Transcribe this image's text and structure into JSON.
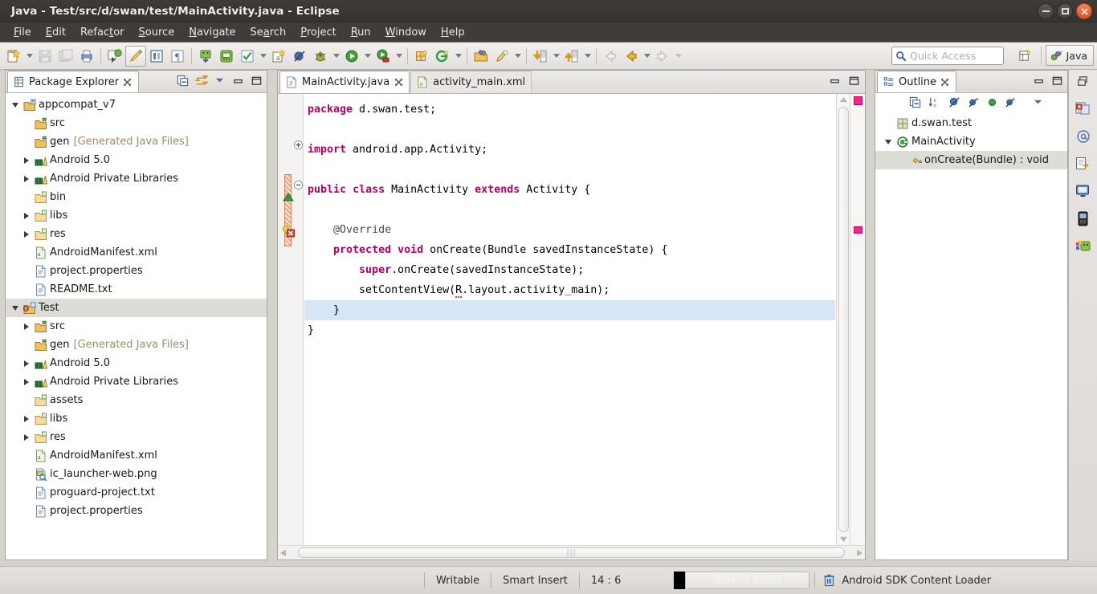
{
  "window": {
    "title": "Java - Test/src/d/swan/test/MainActivity.java - Eclipse",
    "controls": {
      "minimize": "minimize-button",
      "maximize": "maximize-button",
      "close": "close-button"
    }
  },
  "menu": {
    "items": [
      {
        "label": "File",
        "mnemonic": "F"
      },
      {
        "label": "Edit",
        "mnemonic": "E"
      },
      {
        "label": "Refactor",
        "mnemonic": "t"
      },
      {
        "label": "Source",
        "mnemonic": "S"
      },
      {
        "label": "Navigate",
        "mnemonic": "N"
      },
      {
        "label": "Search",
        "mnemonic": "a"
      },
      {
        "label": "Project",
        "mnemonic": "P"
      },
      {
        "label": "Run",
        "mnemonic": "R"
      },
      {
        "label": "Window",
        "mnemonic": "W"
      },
      {
        "label": "Help",
        "mnemonic": "H"
      }
    ]
  },
  "toolbar": {
    "quick_access": {
      "placeholder": "Quick Access",
      "icon": "search-icon"
    },
    "perspective": {
      "label": "Java",
      "icon": "java-perspective-icon",
      "open_perspective_icon": "open-perspective-icon"
    },
    "buttons": [
      "new-wizard-button",
      "save-button",
      "save-all-button",
      "print-button",
      "new-android-app-button",
      "toggle-highlight-button",
      "toggle-block-selection-button",
      "toggle-whitespace-button",
      "android-sdk-manager-button",
      "android-avd-manager-button",
      "check-button",
      "new-java-package-button",
      "skip-breakpoints-button",
      "debug-button",
      "run-button",
      "run-configurations-button",
      "new-android-xml-button",
      "new-android-activity-button",
      "open-type-button",
      "search-button",
      "next-annotation-button",
      "previous-annotation-button",
      "back-button",
      "forward-button"
    ]
  },
  "package_explorer": {
    "title": "Package Explorer",
    "close_icon": "close-view-icon",
    "tools": [
      "collapse-all-icon",
      "link-with-editor-icon",
      "view-menu-icon",
      "minimize-icon",
      "maximize-icon"
    ],
    "tree": [
      {
        "label": "appcompat_v7",
        "indent": 0,
        "twist": "open",
        "icon": "java-project-icon",
        "selected": false
      },
      {
        "label": "src",
        "indent": 1,
        "twist": "none",
        "icon": "source-folder-icon",
        "selected": false
      },
      {
        "label": "gen",
        "indent": 1,
        "twist": "none",
        "icon": "source-folder-icon",
        "suffix": "[Generated Java Files]",
        "selected": false
      },
      {
        "label": "Android 5.0",
        "indent": 1,
        "twist": "closed",
        "icon": "library-icon",
        "selected": false
      },
      {
        "label": "Android Private Libraries",
        "indent": 1,
        "twist": "closed",
        "icon": "library-icon",
        "selected": false
      },
      {
        "label": "bin",
        "indent": 1,
        "twist": "none",
        "icon": "folder-icon",
        "selected": false
      },
      {
        "label": "libs",
        "indent": 1,
        "twist": "closed",
        "icon": "folder-icon",
        "selected": false
      },
      {
        "label": "res",
        "indent": 1,
        "twist": "closed",
        "icon": "folder-icon",
        "selected": false
      },
      {
        "label": "AndroidManifest.xml",
        "indent": 1,
        "twist": "none",
        "icon": "android-xml-icon",
        "selected": false
      },
      {
        "label": "project.properties",
        "indent": 1,
        "twist": "none",
        "icon": "text-file-icon",
        "selected": false
      },
      {
        "label": "README.txt",
        "indent": 1,
        "twist": "none",
        "icon": "text-file-icon",
        "selected": false
      },
      {
        "label": "Test",
        "indent": 0,
        "twist": "open",
        "icon": "java-project-error-icon",
        "selected": true
      },
      {
        "label": "src",
        "indent": 1,
        "twist": "closed",
        "icon": "source-folder-icon",
        "selected": false
      },
      {
        "label": "gen",
        "indent": 1,
        "twist": "none",
        "icon": "source-folder-icon",
        "suffix": "[Generated Java Files]",
        "selected": false
      },
      {
        "label": "Android 5.0",
        "indent": 1,
        "twist": "closed",
        "icon": "library-icon",
        "selected": false
      },
      {
        "label": "Android Private Libraries",
        "indent": 1,
        "twist": "closed",
        "icon": "library-icon",
        "selected": false
      },
      {
        "label": "assets",
        "indent": 1,
        "twist": "none",
        "icon": "folder-icon",
        "selected": false
      },
      {
        "label": "libs",
        "indent": 1,
        "twist": "closed",
        "icon": "folder-icon",
        "selected": false
      },
      {
        "label": "res",
        "indent": 1,
        "twist": "closed",
        "icon": "folder-icon",
        "selected": false
      },
      {
        "label": "AndroidManifest.xml",
        "indent": 1,
        "twist": "none",
        "icon": "android-xml-icon",
        "selected": false
      },
      {
        "label": "ic_launcher-web.png",
        "indent": 1,
        "twist": "none",
        "icon": "image-file-icon",
        "selected": false
      },
      {
        "label": "proguard-project.txt",
        "indent": 1,
        "twist": "none",
        "icon": "text-file-icon",
        "selected": false
      },
      {
        "label": "project.properties",
        "indent": 1,
        "twist": "none",
        "icon": "text-file-icon",
        "selected": false
      }
    ]
  },
  "editor": {
    "tabs": [
      {
        "label": "MainActivity.java",
        "icon": "java-file-icon",
        "active": true,
        "close_icon": "close-tab-icon"
      },
      {
        "label": "activity_main.xml",
        "icon": "android-xml-icon",
        "active": false
      }
    ],
    "tools": [
      "minimize-icon",
      "maximize-icon"
    ],
    "code_lines": [
      {
        "indent": 1,
        "tokens": [
          {
            "t": "package",
            "c": "kw"
          },
          {
            "t": " d.swan.test;",
            "c": ""
          }
        ]
      },
      {
        "indent": 1,
        "tokens": []
      },
      {
        "indent": 1,
        "tokens": [
          {
            "t": "import",
            "c": "kw"
          },
          {
            "t": " android.app.Activity;",
            "c": ""
          }
        ],
        "fold": "collapse"
      },
      {
        "indent": 1,
        "tokens": []
      },
      {
        "indent": 1,
        "tokens": [
          {
            "t": "public",
            "c": "kw"
          },
          {
            "t": " ",
            "c": ""
          },
          {
            "t": "class",
            "c": "kw"
          },
          {
            "t": " MainActivity ",
            "c": ""
          },
          {
            "t": "extends",
            "c": "kw"
          },
          {
            "t": " Activity {",
            "c": ""
          }
        ]
      },
      {
        "indent": 1,
        "tokens": []
      },
      {
        "indent": 2,
        "tokens": [
          {
            "t": "@Override",
            "c": "ann"
          }
        ],
        "fold": "expand"
      },
      {
        "indent": 2,
        "tokens": [
          {
            "t": "protected",
            "c": "kw"
          },
          {
            "t": " ",
            "c": ""
          },
          {
            "t": "void",
            "c": "kw"
          },
          {
            "t": " onCreate(Bundle savedInstanceState) {",
            "c": ""
          }
        ]
      },
      {
        "indent": 3,
        "tokens": [
          {
            "t": "super",
            "c": "kw"
          },
          {
            "t": ".onCreate(savedInstanceState);",
            "c": ""
          }
        ]
      },
      {
        "indent": 3,
        "tokens": [
          {
            "t": "setContentView(",
            "c": ""
          },
          {
            "t": "R",
            "c": "err"
          },
          {
            "t": ".layout.activity_main);",
            "c": ""
          }
        ]
      },
      {
        "indent": 2,
        "tokens": [
          {
            "t": "}",
            "c": ""
          }
        ],
        "highlight": true
      },
      {
        "indent": 1,
        "tokens": [
          {
            "t": "}",
            "c": ""
          }
        ]
      }
    ],
    "markers": {
      "change_bar": "changed-lines-marker",
      "override_marker": "override-indicator-icon",
      "quickfix_marker": "quickfix-error-icon",
      "ruler_top_error": "error-overview-marker",
      "ruler_error": "error-overview-marker"
    },
    "scroll_hint": "|||"
  },
  "outline": {
    "title": "Outline",
    "close_icon": "close-view-icon",
    "tools": [
      "minimize-icon",
      "maximize-icon"
    ],
    "toolbar_icons": [
      "collapse-all-icon",
      "sort-alphabetically-icon",
      "hide-fields-icon",
      "hide-static-icon",
      "hide-non-public-icon",
      "hide-local-types-icon",
      "view-menu-icon"
    ],
    "items": [
      {
        "label": "d.swan.test",
        "indent": 0,
        "twist": "none",
        "icon": "package-icon",
        "selected": false
      },
      {
        "label": "MainActivity",
        "indent": 0,
        "twist": "open",
        "icon": "class-icon",
        "selected": false
      },
      {
        "label": "onCreate(Bundle) : void",
        "indent": 1,
        "twist": "none",
        "icon": "method-protected-icon",
        "selected": true
      }
    ]
  },
  "rail": {
    "icons": [
      "restore-icon",
      "problems-view-icon",
      "at-icon",
      "declaration-view-icon",
      "console-view-icon",
      "devices-view-icon",
      "logcat-view-icon"
    ]
  },
  "status": {
    "writable": "Writable",
    "insert_mode": "Smart Insert",
    "position": "14 : 6",
    "memory": "30M of 495M",
    "job": "Android SDK Content Loader",
    "job_icon": "trash-icon"
  },
  "colors": {
    "titlebar": "#3f3b37",
    "menubar": "#403c39",
    "toolbar": "#f3f1ef",
    "workspace": "#d6d2cc",
    "selection": "#ddddd8",
    "current_line": "#d6e6f7",
    "keyword": "#b30065",
    "error_marker": "#ff1f8f",
    "close_button": "#d9532a"
  }
}
